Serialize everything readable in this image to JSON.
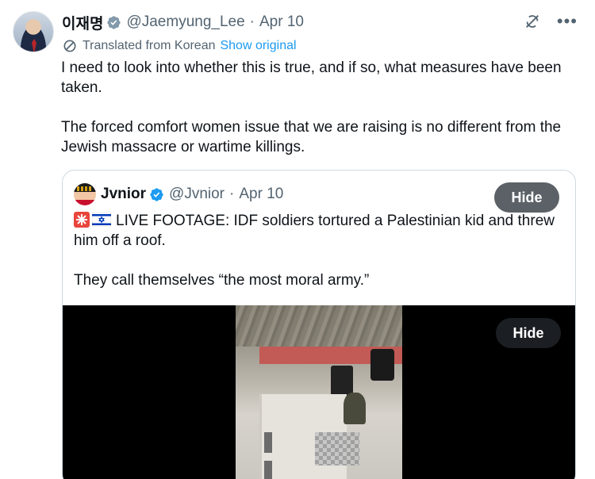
{
  "author": {
    "display_name": "이재명",
    "handle": "@Jaemyung_Lee",
    "separator": "·",
    "date": "Apr 10",
    "verified_icon": "verified-badge-icon",
    "badge_color": "#829aab"
  },
  "translation": {
    "label": "Translated from Korean",
    "link": "Show original",
    "icon": "globe-icon"
  },
  "tweet": {
    "paragraphs": [
      "I need to look into whether this is true, and if so, what measures have been taken.",
      "The forced comfort women issue that we are raising is no different from the Jewish massacre or wartime killings."
    ]
  },
  "quote": {
    "author": {
      "display_name": "Jvnior",
      "handle": "@Jvnior",
      "separator": "·",
      "date": "Apr 10",
      "badge_color": "#1d9bf0"
    },
    "hide_label": "Hide",
    "emojis": [
      "siren-emoji",
      "israel-flag-emoji"
    ],
    "paragraphs": [
      "LIVE FOOTAGE: IDF soldiers tortured a Palestinian kid and threw him off a roof.",
      "They call themselves “the most moral army.”"
    ],
    "media": {
      "hide_label": "Hide"
    }
  },
  "icons": {
    "grok": "grok-icon",
    "more": "more-dots-icon"
  },
  "colors": {
    "link": "#1d9bf0",
    "secondary_text": "#536471",
    "border": "#cfd9de"
  }
}
